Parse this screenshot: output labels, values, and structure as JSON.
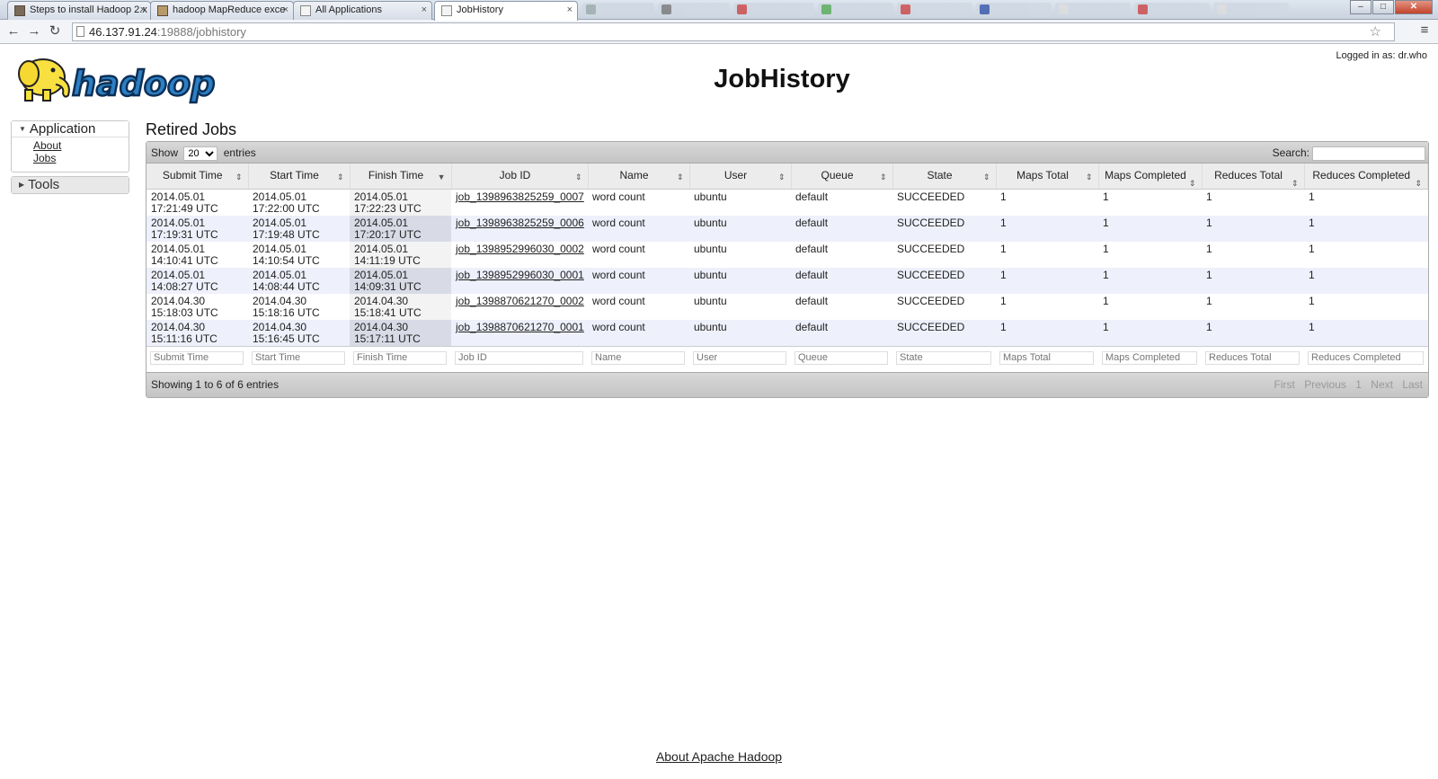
{
  "browser": {
    "tabs": [
      {
        "title": "Steps to install Hadoop 2.x",
        "close": "×"
      },
      {
        "title": "hadoop MapReduce exce",
        "close": "×"
      },
      {
        "title": "All Applications",
        "close": "×"
      },
      {
        "title": "JobHistory",
        "close": "×"
      }
    ],
    "url_host": "46.137.91.24",
    "url_rest": ":19888/jobhistory",
    "nav": {
      "back": "←",
      "forward": "→",
      "reload": "↻"
    },
    "star": "☆",
    "menu": "≡",
    "window": {
      "minimize": "–",
      "maximize": "□",
      "close": "✕"
    }
  },
  "header": {
    "title": "JobHistory",
    "logged_in": "Logged in as: dr.who",
    "logo_text": "hadoop"
  },
  "sidebar": {
    "application": {
      "label": "Application",
      "links": [
        {
          "label": "About"
        },
        {
          "label": "Jobs"
        }
      ]
    },
    "tools": {
      "label": "Tools"
    }
  },
  "jobs": {
    "title": "Retired Jobs",
    "show_label": "Show",
    "entries_value": "20",
    "entries_label": "entries",
    "search_label": "Search:",
    "columns": [
      {
        "label": "Submit Time"
      },
      {
        "label": "Start Time"
      },
      {
        "label": "Finish Time"
      },
      {
        "label": "Job ID"
      },
      {
        "label": "Name"
      },
      {
        "label": "User"
      },
      {
        "label": "Queue"
      },
      {
        "label": "State"
      },
      {
        "label": "Maps Total"
      },
      {
        "label": "Maps Completed"
      },
      {
        "label": "Reduces Total"
      },
      {
        "label": "Reduces Completed"
      }
    ],
    "rows": [
      {
        "submit_date": "2014.05.01",
        "submit_time": "17:21:49 UTC",
        "start_date": "2014.05.01",
        "start_time": "17:22:00 UTC",
        "finish_date": "2014.05.01",
        "finish_time": "17:22:23 UTC",
        "job_id": "job_1398963825259_0007",
        "name": "word count",
        "user": "ubuntu",
        "queue": "default",
        "state": "SUCCEEDED",
        "maps_total": "1",
        "maps_completed": "1",
        "reduces_total": "1",
        "reduces_completed": "1"
      },
      {
        "submit_date": "2014.05.01",
        "submit_time": "17:19:31 UTC",
        "start_date": "2014.05.01",
        "start_time": "17:19:48 UTC",
        "finish_date": "2014.05.01",
        "finish_time": "17:20:17 UTC",
        "job_id": "job_1398963825259_0006",
        "name": "word count",
        "user": "ubuntu",
        "queue": "default",
        "state": "SUCCEEDED",
        "maps_total": "1",
        "maps_completed": "1",
        "reduces_total": "1",
        "reduces_completed": "1"
      },
      {
        "submit_date": "2014.05.01",
        "submit_time": "14:10:41 UTC",
        "start_date": "2014.05.01",
        "start_time": "14:10:54 UTC",
        "finish_date": "2014.05.01",
        "finish_time": "14:11:19 UTC",
        "job_id": "job_1398952996030_0002",
        "name": "word count",
        "user": "ubuntu",
        "queue": "default",
        "state": "SUCCEEDED",
        "maps_total": "1",
        "maps_completed": "1",
        "reduces_total": "1",
        "reduces_completed": "1"
      },
      {
        "submit_date": "2014.05.01",
        "submit_time": "14:08:27 UTC",
        "start_date": "2014.05.01",
        "start_time": "14:08:44 UTC",
        "finish_date": "2014.05.01",
        "finish_time": "14:09:31 UTC",
        "job_id": "job_1398952996030_0001",
        "name": "word count",
        "user": "ubuntu",
        "queue": "default",
        "state": "SUCCEEDED",
        "maps_total": "1",
        "maps_completed": "1",
        "reduces_total": "1",
        "reduces_completed": "1"
      },
      {
        "submit_date": "2014.04.30",
        "submit_time": "15:18:03 UTC",
        "start_date": "2014.04.30",
        "start_time": "15:18:16 UTC",
        "finish_date": "2014.04.30",
        "finish_time": "15:18:41 UTC",
        "job_id": "job_1398870621270_0002",
        "name": "word count",
        "user": "ubuntu",
        "queue": "default",
        "state": "SUCCEEDED",
        "maps_total": "1",
        "maps_completed": "1",
        "reduces_total": "1",
        "reduces_completed": "1"
      },
      {
        "submit_date": "2014.04.30",
        "submit_time": "15:11:16 UTC",
        "start_date": "2014.04.30",
        "start_time": "15:16:45 UTC",
        "finish_date": "2014.04.30",
        "finish_time": "15:17:11 UTC",
        "job_id": "job_1398870621270_0001",
        "name": "word count",
        "user": "ubuntu",
        "queue": "default",
        "state": "SUCCEEDED",
        "maps_total": "1",
        "maps_completed": "1",
        "reduces_total": "1",
        "reduces_completed": "1"
      }
    ],
    "info": "Showing 1 to 6 of 6 entries",
    "pager": {
      "first": "First",
      "previous": "Previous",
      "page": "1",
      "next": "Next",
      "last": "Last"
    }
  },
  "footer": {
    "link": "About Apache Hadoop"
  },
  "colors": {
    "logo_blue": "#1f6fb5",
    "elephant_yellow": "#f8e040",
    "row_alt": "#eef0fb"
  }
}
